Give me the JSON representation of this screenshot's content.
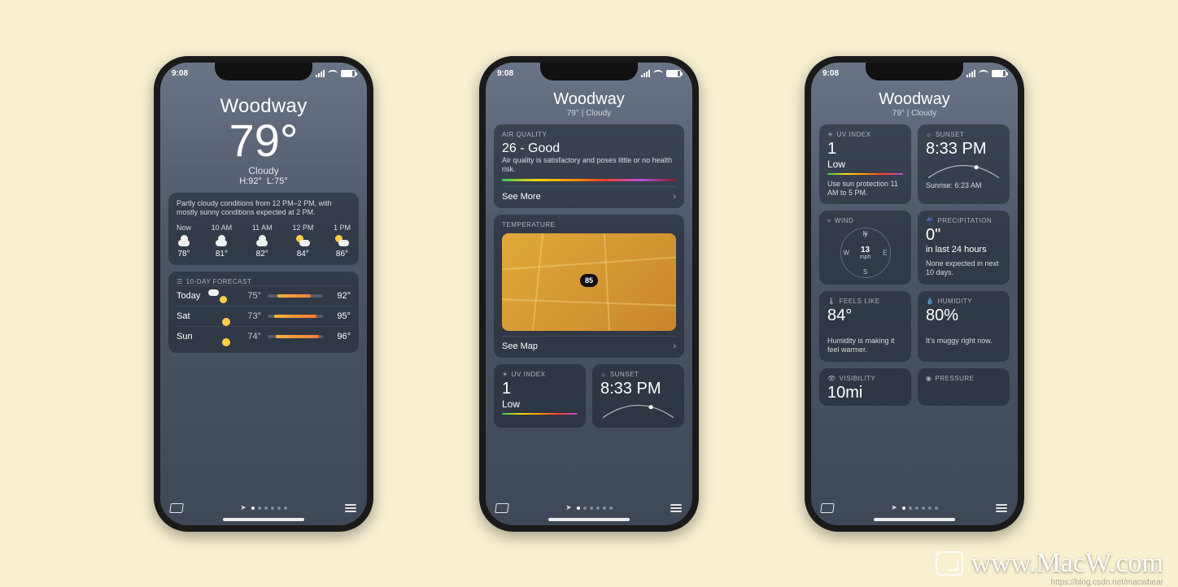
{
  "watermark": "www.MacW.com",
  "watermark_small": "https://blog.csdn.net/macwbear",
  "status": {
    "time": "9:08",
    "carrier_bars": 4
  },
  "common": {
    "city": "Woodway",
    "map_button": "Map",
    "list_button": "List"
  },
  "phone1": {
    "temp": "79°",
    "condition": "Cloudy",
    "hi": "H:92°",
    "lo": "L:75°",
    "summary": "Partly cloudy conditions from 12 PM–2 PM, with mostly sunny conditions expected at 2 PM.",
    "hourly": [
      {
        "label": "Now",
        "icon": "cloud",
        "temp": "78°"
      },
      {
        "label": "10 AM",
        "icon": "cloud",
        "temp": "81°"
      },
      {
        "label": "11 AM",
        "icon": "cloud",
        "temp": "82°"
      },
      {
        "label": "12 PM",
        "icon": "partly",
        "temp": "84°"
      },
      {
        "label": "1 PM",
        "icon": "partly",
        "temp": "86°"
      }
    ],
    "forecast_title": "10-DAY FORECAST",
    "forecast": [
      {
        "day": "Today",
        "icon": "partly",
        "lo": "75°",
        "hi": "92°",
        "from": 18,
        "to": 78
      },
      {
        "day": "Sat",
        "icon": "sun",
        "lo": "73°",
        "hi": "95°",
        "from": 12,
        "to": 88
      },
      {
        "day": "Sun",
        "icon": "sun",
        "lo": "74°",
        "hi": "96°",
        "from": 14,
        "to": 92
      }
    ]
  },
  "phone2": {
    "subtitle": "79° | Cloudy",
    "aqi_title": "AIR QUALITY",
    "aqi_headline": "26 - Good",
    "aqi_desc": "Air quality is satisfactory and poses little or no health risk.",
    "see_more": "See More",
    "temp_map_title": "TEMPERATURE",
    "map_pin": "85",
    "see_map": "See Map",
    "uv_title": "UV INDEX",
    "uv_value": "1",
    "uv_level": "Low",
    "sunset_title": "SUNSET",
    "sunset_value": "8:33 PM"
  },
  "phone3": {
    "subtitle": "79° | Cloudy",
    "uv_title": "UV INDEX",
    "uv_value": "1",
    "uv_level": "Low",
    "uv_note": "Use sun protection 11 AM to 5 PM.",
    "sunset_title": "SUNSET",
    "sunset_value": "8:33 PM",
    "sunrise_note": "Sunrise: 6:23 AM",
    "wind_title": "WIND",
    "wind_value": "13",
    "wind_unit": "mph",
    "precip_title": "PRECIPITATION",
    "precip_value": "0\"",
    "precip_sub": "in last 24 hours",
    "precip_note": "None expected in next 10 days.",
    "feels_title": "FEELS LIKE",
    "feels_value": "84°",
    "feels_note": "Humidity is making it feel warmer.",
    "humidity_title": "HUMIDITY",
    "humidity_value": "80%",
    "humidity_note": "It's muggy right now.",
    "visibility_title": "VISIBILITY",
    "visibility_value": "10mi",
    "pressure_title": "PRESSURE"
  }
}
